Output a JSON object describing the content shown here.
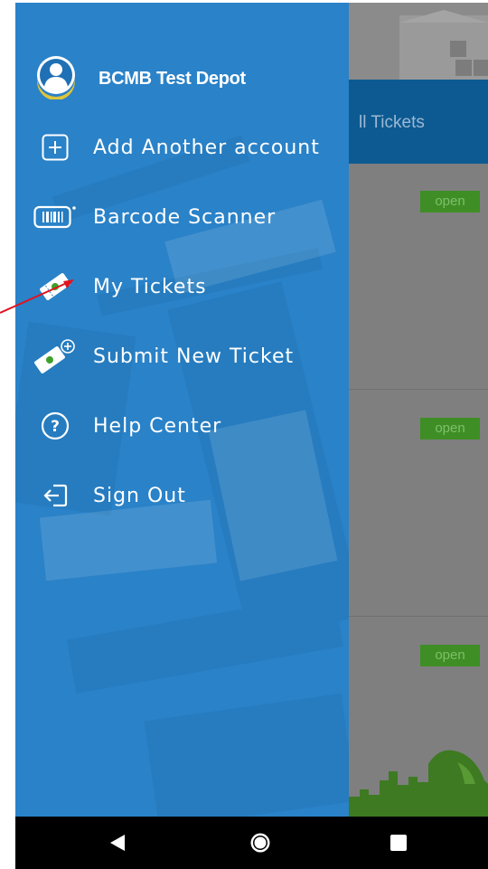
{
  "account": {
    "name": "BCMB Test Depot"
  },
  "menu": {
    "items": [
      {
        "label": "Add Another account",
        "icon": "add-square-icon"
      },
      {
        "label": "Barcode Scanner",
        "icon": "barcode-icon"
      },
      {
        "label": "My Tickets",
        "icon": "ticket-icon"
      },
      {
        "label": "Submit New Ticket",
        "icon": "ticket-add-icon"
      },
      {
        "label": "Help Center",
        "icon": "help-circle-icon"
      },
      {
        "label": "Sign Out",
        "icon": "sign-out-icon"
      }
    ]
  },
  "background": {
    "tab_label": "ll Tickets",
    "badges": [
      "open",
      "open",
      "open"
    ]
  },
  "colors": {
    "drawer": "#2a82c8",
    "toolbar": "#0d5a92",
    "badge": "#3e8e25",
    "annotation_arrow": "#e0141e"
  },
  "navbar": {
    "buttons": [
      "back",
      "home",
      "recents"
    ]
  }
}
